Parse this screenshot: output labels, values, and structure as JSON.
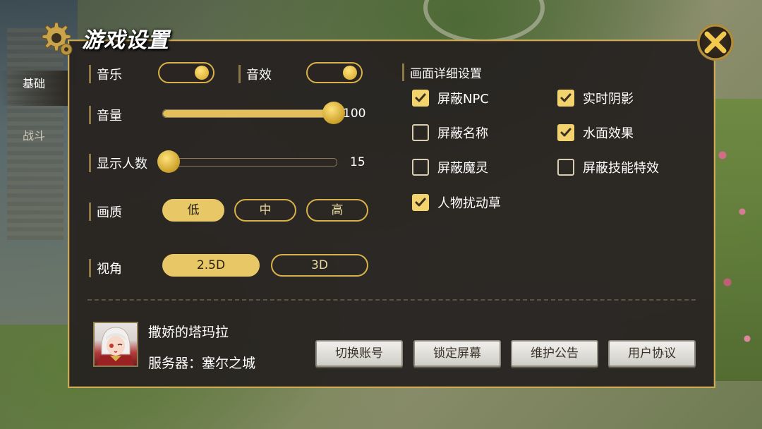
{
  "title": "游戏设置",
  "tabs": [
    {
      "label": "基础",
      "active": true
    },
    {
      "label": "战斗",
      "active": false
    }
  ],
  "settings": {
    "music": {
      "label": "音乐",
      "on": true
    },
    "sound_effect": {
      "label": "音效",
      "on": true
    },
    "volume": {
      "label": "音量",
      "value": "100",
      "fraction": 1.0
    },
    "player_count": {
      "label": "显示人数",
      "value": "15",
      "fraction": 0.0
    },
    "quality": {
      "label": "画质",
      "options": [
        "低",
        "中",
        "高"
      ],
      "selected": "低"
    },
    "view_angle": {
      "label": "视角",
      "options": [
        "2.5D",
        "3D"
      ],
      "selected": "2.5D"
    }
  },
  "detail_settings": {
    "header": "画面详细设置",
    "items": [
      {
        "label": "屏蔽NPC",
        "checked": true
      },
      {
        "label": "实时阴影",
        "checked": true
      },
      {
        "label": "屏蔽名称",
        "checked": false
      },
      {
        "label": "水面效果",
        "checked": true
      },
      {
        "label": "屏蔽魔灵",
        "checked": false
      },
      {
        "label": "屏蔽技能特效",
        "checked": false
      },
      {
        "label": "人物扰动草",
        "checked": true
      }
    ]
  },
  "account": {
    "name": "撒娇的塔玛拉",
    "server": "服务器：塞尔之城"
  },
  "actions": {
    "switch_account": "切换账号",
    "lock_screen": "锁定屏幕",
    "maintenance": "维护公告",
    "user_agreement": "用户协议"
  },
  "colors": {
    "accent": "#e8c766",
    "panel_bg": "#262221",
    "border": "#c9a95a"
  }
}
